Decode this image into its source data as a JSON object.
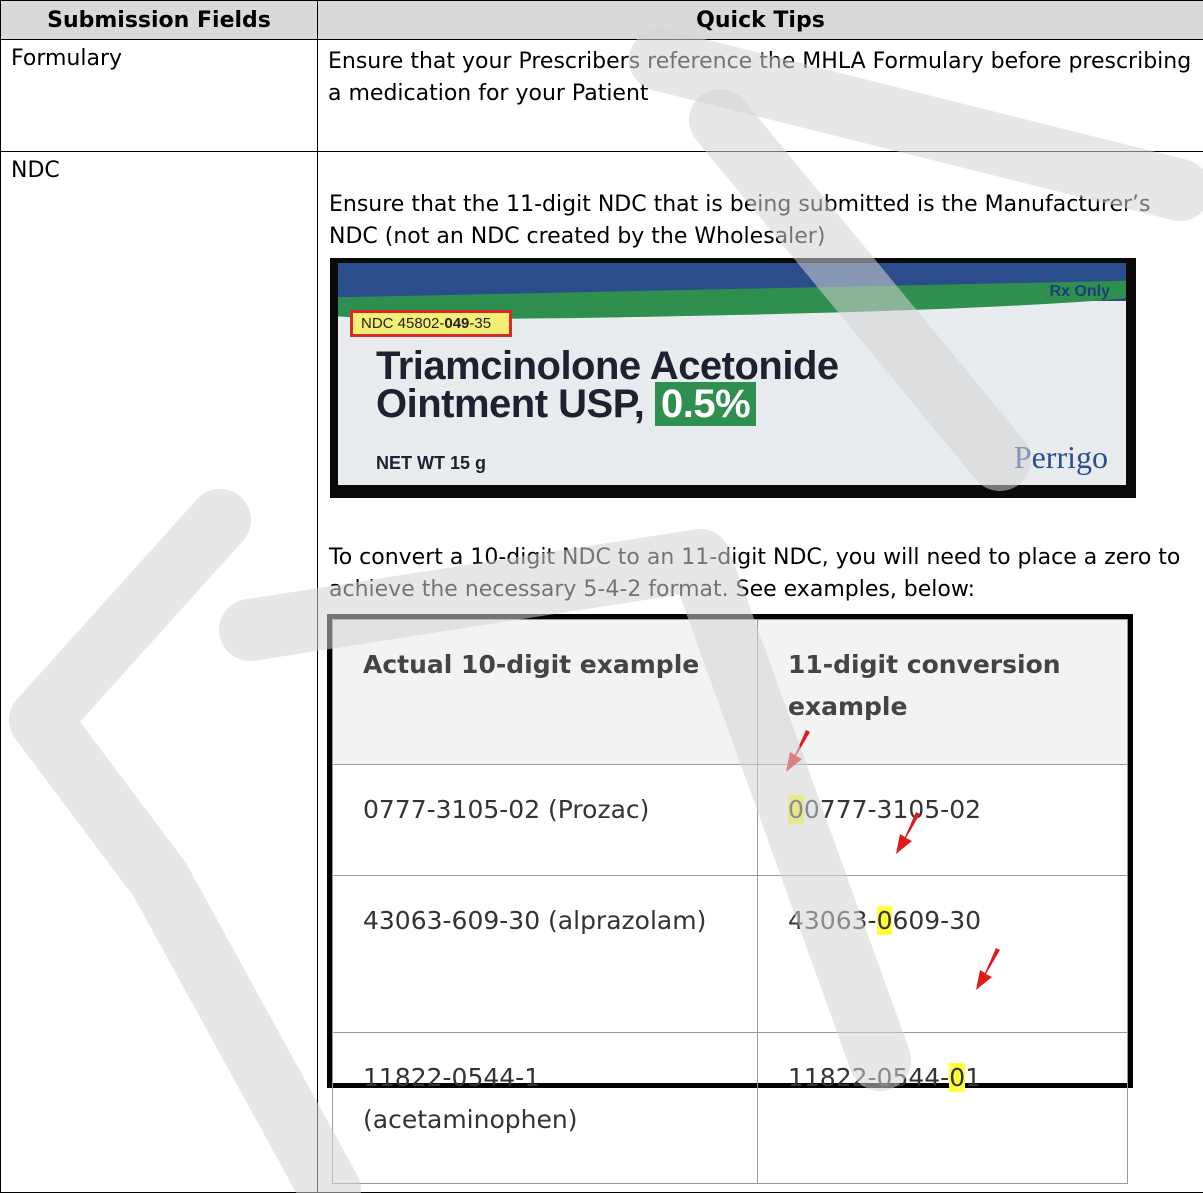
{
  "table": {
    "header": {
      "col1": "Submission Fields",
      "col2": "Quick Tips"
    },
    "rows": [
      {
        "field": "Formulary",
        "tip": "Ensure that your Prescribers reference the MHLA Formulary before prescribing a medication for your Patient"
      },
      {
        "field": "NDC",
        "tip_intro": "Ensure that the 11-digit NDC that is being submitted is the Manufacturer’s NDC (not an NDC created by the Wholesaler)",
        "tip_convert": "To convert a 10-digit NDC to an 11-digit NDC, you will need to place a zero to achieve the necessary 5-4-2 format. See examples, below:"
      }
    ]
  },
  "product_image": {
    "rx_label": "Rx Only",
    "ndc_prefix": "NDC 45802-",
    "ndc_bold": "049",
    "ndc_suffix": "-35",
    "name_line1": "Triamcinolone Acetonide",
    "name_line2": "Ointment USP,",
    "strength": "0.5%",
    "net_weight": "NET WT 15 g",
    "brand": "Perrigo"
  },
  "conversion_table": {
    "headers": [
      "Actual 10-digit example",
      "11-digit conversion example"
    ],
    "rows": [
      {
        "actual": "0777-3105-02 (Prozac)",
        "pre": "",
        "zero": "0",
        "post": "0777-3105-02"
      },
      {
        "actual": "43063-609-30 (alprazolam)",
        "pre": "43063-",
        "zero": "0",
        "post": "609-30"
      },
      {
        "actual": "11822-0544-1 (acetaminophen)",
        "pre": "11822-0544-",
        "zero": "0",
        "post": "1"
      }
    ]
  },
  "colors": {
    "header_bg": "#d9d9d9",
    "highlight": "#ffff3c",
    "arrow": "#e01b1b",
    "watermark": "#e3e3e3"
  }
}
